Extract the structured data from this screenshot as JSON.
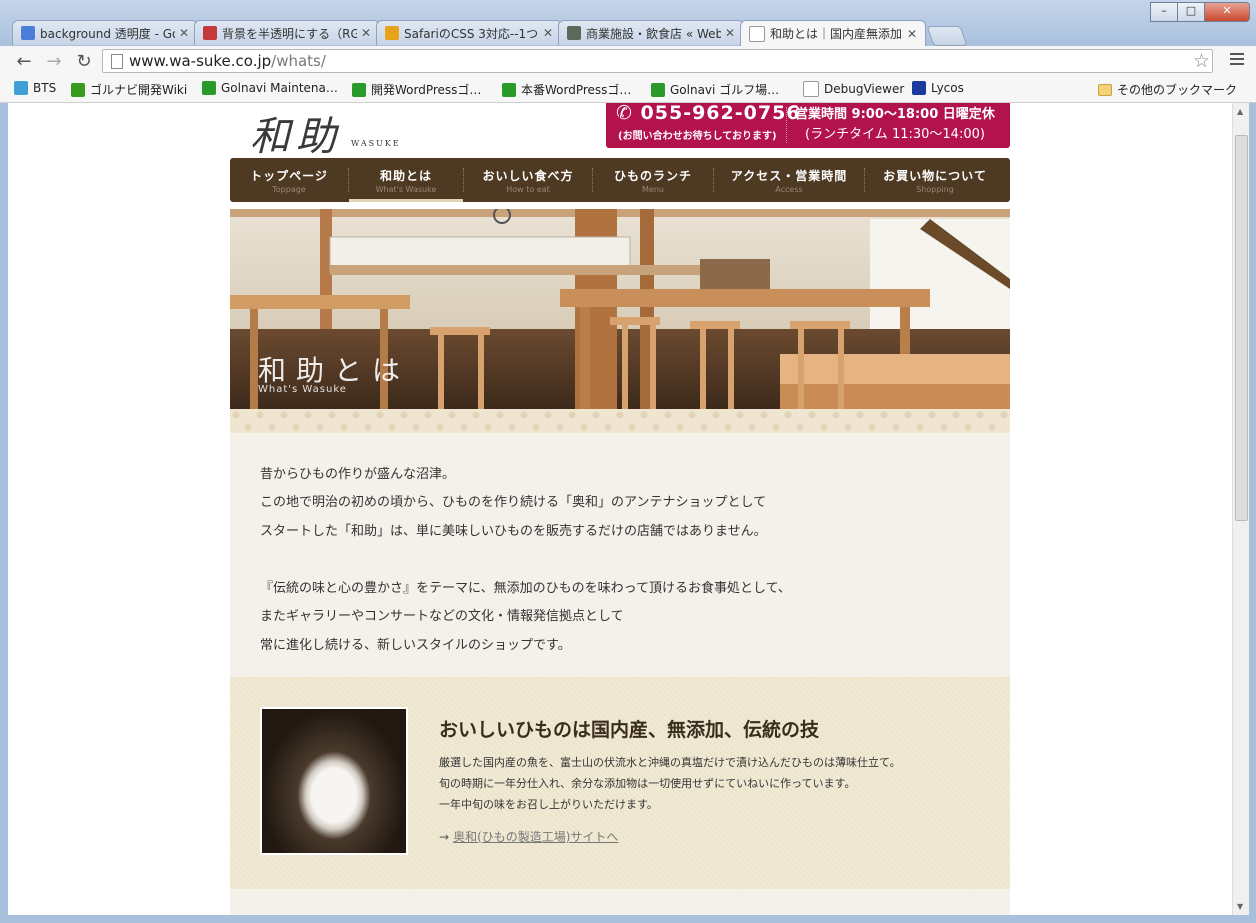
{
  "window": {
    "tabs": [
      {
        "title": "background 透明度 - Go",
        "icon": "google-icon",
        "icon_color": "#4a7ed8"
      },
      {
        "title": "背景を半透明にする（RG",
        "icon": "hatena-icon",
        "icon_color": "#c43a3a"
      },
      {
        "title": "SafariのCSS 3対応--1つ",
        "icon": "safari-icon",
        "icon_color": "#e8a21a"
      },
      {
        "title": "商業施設・飲食店 « Web",
        "icon": "s-site-icon",
        "icon_color": "#5b6b5b"
      },
      {
        "title": "和助とは｜国内産無添加",
        "icon": "page-icon",
        "icon_color": "#ffffff"
      }
    ],
    "close_symbol": "✕",
    "minimize_symbol": "–",
    "maximize_symbol": "□"
  },
  "toolbar": {
    "back": "←",
    "forward": "→",
    "reload": "↻",
    "url_host": "www.wa-suke.co.jp",
    "url_path": "/whats/",
    "star": "☆"
  },
  "bookmarks": [
    {
      "label": "BTS",
      "icon": "m-icon",
      "color": "#3fa0d8"
    },
    {
      "label": "ゴルナビ開発Wiki",
      "icon": "wiki-icon",
      "color": "#3a9a1a"
    },
    {
      "label": "Golnavi Maintena…",
      "icon": "bookmark-green-icon",
      "color": "#2a9a2a"
    },
    {
      "label": "開発WordPressゴ…",
      "icon": "bookmark-green-icon",
      "color": "#2a9a2a"
    },
    {
      "label": "本番WordPressゴ…",
      "icon": "bookmark-green-icon",
      "color": "#2a9a2a"
    },
    {
      "label": "Golnavi ゴルフ場…",
      "icon": "bookmark-green-icon",
      "color": "#2a9a2a"
    },
    {
      "label": "DebugViewer",
      "icon": "page-icon",
      "color": "#ffffff"
    },
    {
      "label": "Lycos",
      "icon": "lycos-icon",
      "color": "#1a3aa0"
    }
  ],
  "other_bookmarks": "その他のブックマーク",
  "site": {
    "logo": "和助",
    "logo_sub": "WASUKE",
    "phone": "✆ 055-962-0756",
    "phone_note": "(お問い合わせお待ちしております)",
    "hours": "営業時間 9:00～18:00 日曜定休",
    "lunch": "(ランチタイム 11:30～14:00)",
    "nav": [
      {
        "jp": "トップページ",
        "en": "Toppage"
      },
      {
        "jp": "和助とは",
        "en": "What's Wasuke"
      },
      {
        "jp": "おいしい食べ方",
        "en": "How to eat"
      },
      {
        "jp": "ひものランチ",
        "en": "Menu"
      },
      {
        "jp": "アクセス・営業時間",
        "en": "Access"
      },
      {
        "jp": "お買い物について",
        "en": "Shopping"
      }
    ],
    "hero_title": "和助とは",
    "hero_sub": "What's Wasuke",
    "intro": [
      "昔からひもの作りが盛んな沼津。",
      "この地で明治の初めの頃から、ひものを作り続ける「奥和」のアンテナショップとして",
      "スタートした「和助」は、単に美味しいひものを販売するだけの店舗ではありません。",
      "『伝統の味と心の豊かさ』をテーマに、無添加のひものを味わって頂けるお食事処として、",
      "またギャラリーやコンサートなどの文化・情報発信拠点として",
      "常に進化し続ける、新しいスタイルのショップです。"
    ],
    "feature": {
      "title": "おいしいひものは国内産、無添加、伝統の技",
      "lines": [
        "厳選した国内産の魚を、富士山の伏流水と沖縄の真塩だけで漬け込んだひものは薄味仕立て。",
        "旬の時期に一年分仕入れ、余分な添加物は一切使用せずにていねいに作っています。",
        "一年中旬の味をお召し上がりいただけます。"
      ],
      "link": "奥和(ひもの製造工場)サイトへ"
    }
  },
  "colors": {
    "accent": "#b3134c",
    "nav_bg": "#4e3923",
    "intro_bg": "#f4f1ea",
    "feature_bg": "#ede4cc"
  }
}
